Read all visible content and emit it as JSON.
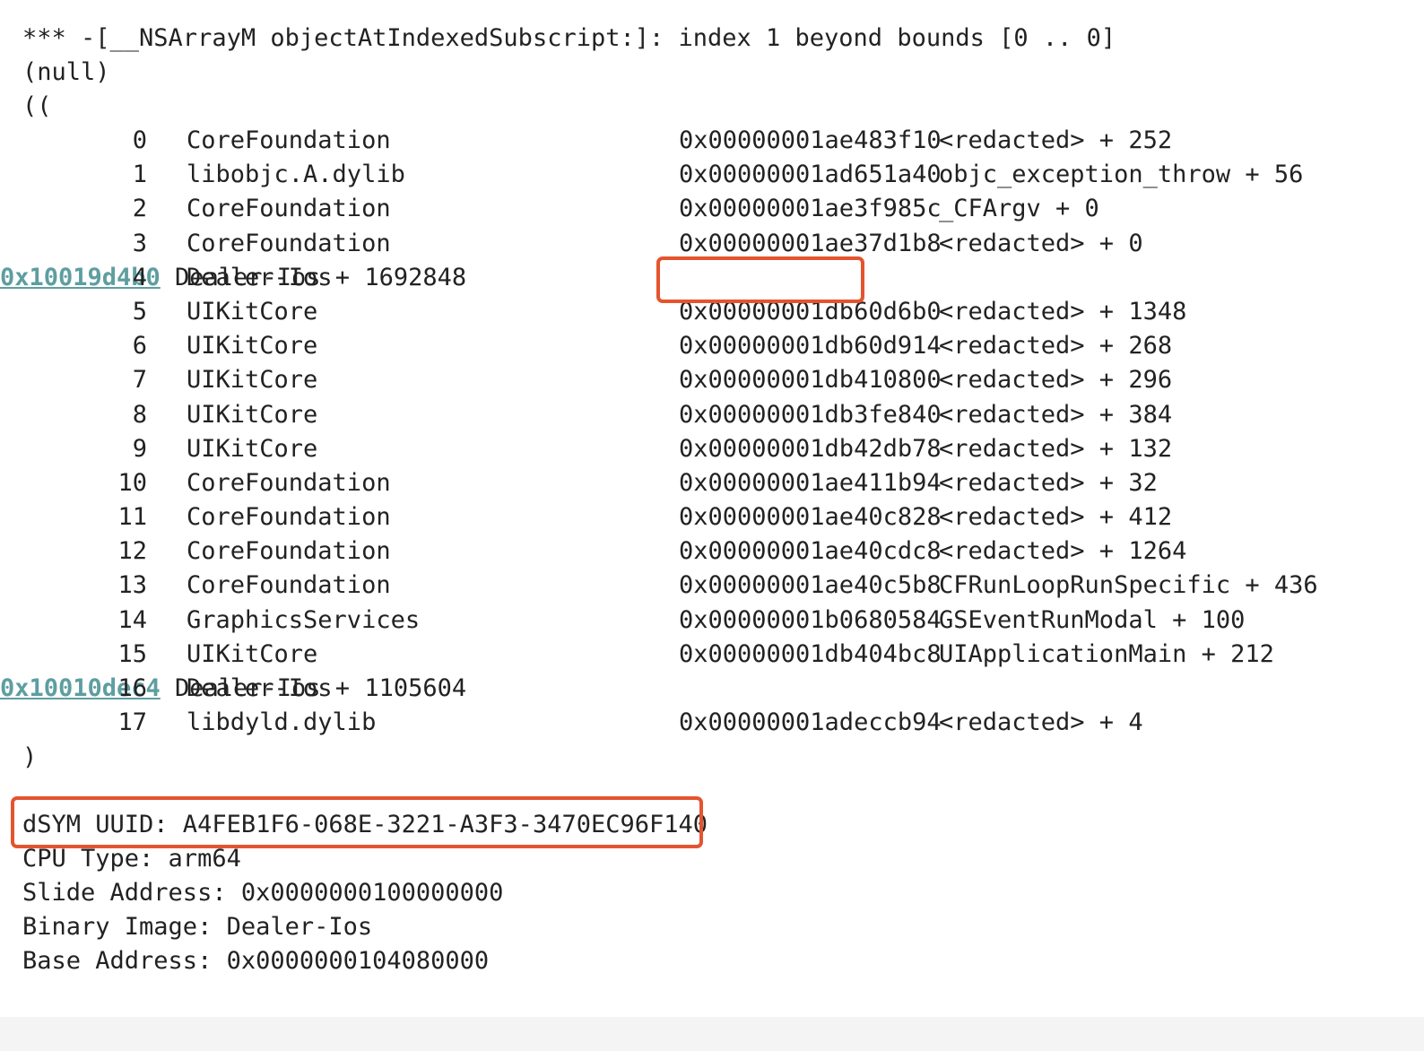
{
  "log": {
    "exception_line": "*** -[__NSArrayM objectAtIndexedSubscript:]: index 1 beyond bounds [0 .. 0]",
    "null_line": "(null)",
    "open_line": "((",
    "close_line": ")",
    "frames": [
      {
        "index": "0",
        "library": "CoreFoundation",
        "address": "0x00000001ae483f10",
        "symbol": "<redacted> + 252",
        "link": false
      },
      {
        "index": "1",
        "library": "libobjc.A.dylib",
        "address": "0x00000001ad651a40",
        "symbol": "objc_exception_throw + 56",
        "link": false
      },
      {
        "index": "2",
        "library": "CoreFoundation",
        "address": "0x00000001ae3f985c",
        "symbol": "_CFArgv + 0",
        "link": false
      },
      {
        "index": "3",
        "library": "CoreFoundation",
        "address": "0x00000001ae37d1b8",
        "symbol": "<redacted> + 0",
        "link": false
      },
      {
        "index": "4",
        "library": "Dealer-Ios",
        "address": "0x10019d4b0",
        "symbol": "Dealer-Ios + 1692848",
        "link": true
      },
      {
        "index": "5",
        "library": "UIKitCore",
        "address": "0x00000001db60d6b0",
        "symbol": "<redacted> + 1348",
        "link": false
      },
      {
        "index": "6",
        "library": "UIKitCore",
        "address": "0x00000001db60d914",
        "symbol": "<redacted> + 268",
        "link": false
      },
      {
        "index": "7",
        "library": "UIKitCore",
        "address": "0x00000001db410800",
        "symbol": "<redacted> + 296",
        "link": false
      },
      {
        "index": "8",
        "library": "UIKitCore",
        "address": "0x00000001db3fe840",
        "symbol": "<redacted> + 384",
        "link": false
      },
      {
        "index": "9",
        "library": "UIKitCore",
        "address": "0x00000001db42db78",
        "symbol": "<redacted> + 132",
        "link": false
      },
      {
        "index": "10",
        "library": "CoreFoundation",
        "address": "0x00000001ae411b94",
        "symbol": "<redacted> + 32",
        "link": false
      },
      {
        "index": "11",
        "library": "CoreFoundation",
        "address": "0x00000001ae40c828",
        "symbol": "<redacted> + 412",
        "link": false
      },
      {
        "index": "12",
        "library": "CoreFoundation",
        "address": "0x00000001ae40cdc8",
        "symbol": "<redacted> + 1264",
        "link": false
      },
      {
        "index": "13",
        "library": "CoreFoundation",
        "address": "0x00000001ae40c5b8",
        "symbol": "CFRunLoopRunSpecific + 436",
        "link": false
      },
      {
        "index": "14",
        "library": "GraphicsServices",
        "address": "0x00000001b0680584",
        "symbol": "GSEventRunModal + 100",
        "link": false
      },
      {
        "index": "15",
        "library": "UIKitCore",
        "address": "0x00000001db404bc8",
        "symbol": "UIApplicationMain + 212",
        "link": false
      },
      {
        "index": "16",
        "library": "Dealer-Ios",
        "address": "0x10010dec4",
        "symbol": "Dealer-Ios + 1105604",
        "link": true
      },
      {
        "index": "17",
        "library": "libdyld.dylib",
        "address": "0x00000001adeccb94",
        "symbol": "<redacted> + 4",
        "link": false
      }
    ]
  },
  "info": {
    "dsym_uuid": "dSYM UUID: A4FEB1F6-068E-3221-A3F3-3470EC96F140",
    "cpu_type": "CPU Type: arm64",
    "slide_address": "Slide Address: 0x0000000100000000",
    "binary_image": "Binary Image: Dealer-Ios",
    "base_address": "Base Address: 0x0000000104080000"
  },
  "colors": {
    "highlight": "#e4542e",
    "link": "#5e9ea0",
    "text": "#222222"
  }
}
